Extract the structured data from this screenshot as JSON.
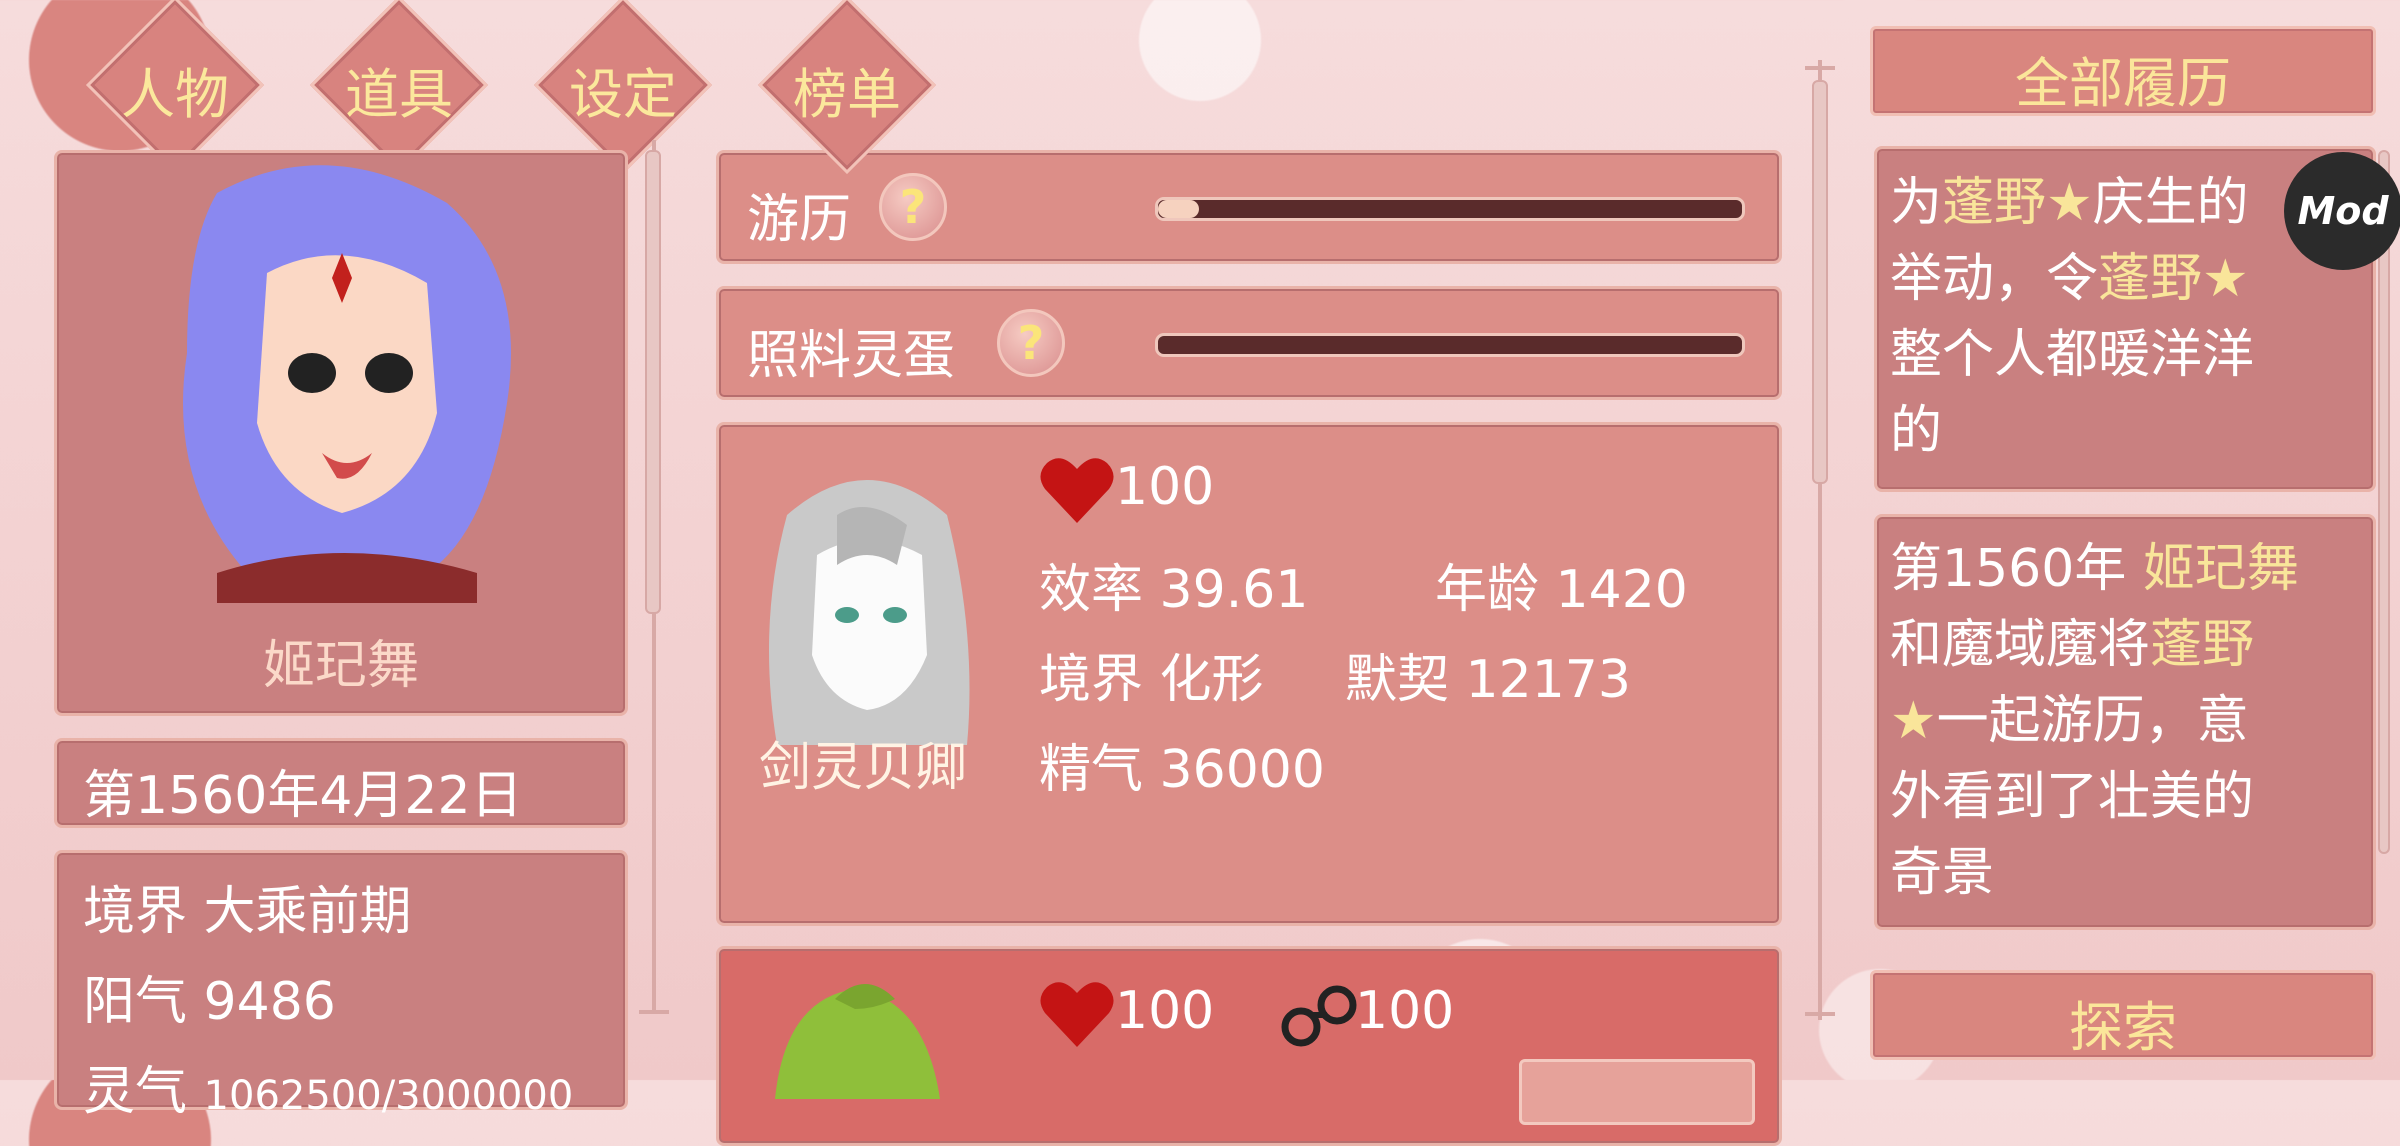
{
  "tabs": [
    {
      "label": "人物"
    },
    {
      "label": "道具"
    },
    {
      "label": "设定"
    },
    {
      "label": "榜单"
    }
  ],
  "character": {
    "name": "姬玘舞",
    "date": "第1560年4月22日",
    "realm_label": "境界",
    "realm_value": "大乘前期",
    "yang_label": "阳气",
    "yang_value": "9486",
    "ling_label": "灵气",
    "ling_value": "1062500/3000000"
  },
  "activities": [
    {
      "label": "游历",
      "help": "?",
      "progress": 0.07
    },
    {
      "label": "照料灵蛋",
      "help": "?",
      "progress": 0.16
    }
  ],
  "companions": [
    {
      "name": "剑灵贝卿",
      "heart": "100",
      "eff_label": "效率",
      "eff_value": "39.61",
      "age_label": "年龄",
      "age_value": "1420",
      "realm_label": "境界",
      "realm_value": "化形",
      "bond_label": "默契",
      "bond_value": "12173",
      "essence_label": "精气",
      "essence_value": "36000"
    },
    {
      "heart": "100",
      "cuff": "100"
    }
  ],
  "history": {
    "title": "全部履历",
    "entry1": [
      {
        "plain": "为",
        "gold": "蓬野★",
        "plain2": "庆生的"
      },
      {
        "plain": "举动，令",
        "gold": "蓬野★",
        "plain2": ""
      },
      {
        "plain": "整个人都暖洋洋",
        "gold": "",
        "plain2": ""
      },
      {
        "plain": "的",
        "gold": "",
        "plain2": ""
      }
    ],
    "entry2": [
      {
        "plain": "第1560年 ",
        "gold": "姬玘舞",
        "plain2": ""
      },
      {
        "plain": "和魔域魔将",
        "gold": "蓬野",
        "plain2": ""
      },
      {
        "plain": "",
        "gold": "★",
        "plain2": "一起游历，意"
      },
      {
        "plain": "外看到了壮美的",
        "gold": "",
        "plain2": ""
      },
      {
        "plain": "奇景",
        "gold": "",
        "plain2": ""
      }
    ],
    "explore_label": "探索"
  },
  "mod_badge": "Mod",
  "colors": {
    "gold_text": "#f9e59a",
    "panel": "#c98080",
    "heart": "#c41414"
  }
}
